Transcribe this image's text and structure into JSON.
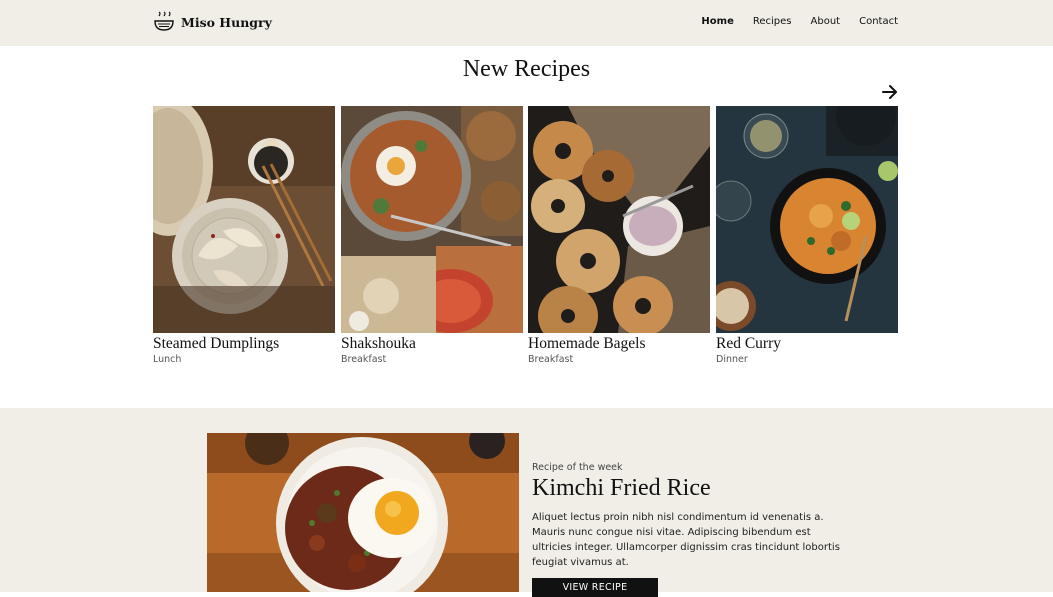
{
  "brand": {
    "name": "Miso Hungry",
    "icon": "bowl-icon"
  },
  "nav": {
    "items": [
      "Home",
      "Recipes",
      "About",
      "Contact"
    ],
    "active": "Home"
  },
  "new_recipes": {
    "title": "New Recipes",
    "next_icon": "arrow-right-icon",
    "cards": [
      {
        "title": "Steamed Dumplings",
        "category": "Lunch"
      },
      {
        "title": "Shakshouka",
        "category": "Breakfast"
      },
      {
        "title": "Homemade Bagels",
        "category": "Breakfast"
      },
      {
        "title": "Red Curry",
        "category": "Dinner"
      }
    ]
  },
  "feature": {
    "eyebrow": "Recipe of the week",
    "title": "Kimchi Fried Rice",
    "description": "Aliquet lectus proin nibh nisl condimentum id venenatis a. Mauris nunc congue nisi vitae. Adipiscing bibendum est ultricies integer. Ullamcorper dignissim cras tincidunt lobortis feugiat vivamus at.",
    "button": "VIEW RECIPE"
  },
  "colors": {
    "header_bg": "#f0eee6",
    "button_bg": "#111111",
    "button_text": "#ffffff"
  }
}
